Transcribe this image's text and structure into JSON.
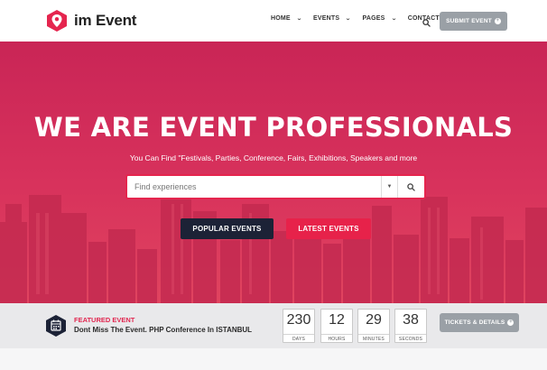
{
  "brand": {
    "logo_text": "im Event",
    "accent": "#e5254e",
    "dark": "#1c2236",
    "gray_button": "#9aa0a6"
  },
  "nav": {
    "items": [
      {
        "label": "HOME",
        "has_dropdown": true
      },
      {
        "label": "EVENTS",
        "has_dropdown": true
      },
      {
        "label": "PAGES",
        "has_dropdown": true
      },
      {
        "label": "CONTACT US",
        "has_dropdown": false
      }
    ],
    "search_icon": "search-icon",
    "submit_label": "SUBMIT EVENT"
  },
  "hero": {
    "title": "WE ARE EVENT PROFESSIONALS",
    "subtitle": "You Can Find \"Festivals, Parties, Conference, Fairs, Exhibitions, Speakers and more",
    "search_placeholder": "Find experiences",
    "popular_label": "POPULAR EVENTS",
    "latest_label": "LATEST EVENTS"
  },
  "featured": {
    "label": "FEATURED EVENT",
    "title": "Dont Miss The Event. PHP Conference In ISTANBUL",
    "icon": "calendar-icon",
    "countdown": [
      {
        "value": "230",
        "unit": "DAYS"
      },
      {
        "value": "12",
        "unit": "HOURS"
      },
      {
        "value": "29",
        "unit": "MINUTES"
      },
      {
        "value": "38",
        "unit": "SECONDS"
      }
    ],
    "tickets_label": "TICKETS & DETAILS"
  }
}
